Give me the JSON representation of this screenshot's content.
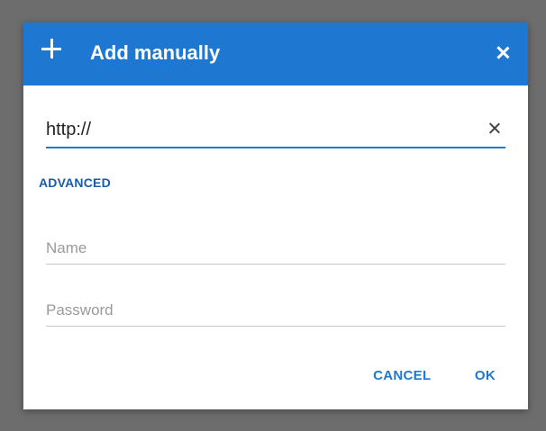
{
  "dialog": {
    "title": "Add manually",
    "header_color": "#1e78d2"
  },
  "url_input": {
    "value": "http://"
  },
  "advanced_label": "ADVANCED",
  "name_input": {
    "placeholder": "Name"
  },
  "password_input": {
    "placeholder": "Password"
  },
  "actions": {
    "cancel_label": "CANCEL",
    "ok_label": "OK"
  },
  "icons": {
    "header_left": "plus-icon",
    "header_right": "close-icon",
    "url_clear": "clear-icon"
  }
}
